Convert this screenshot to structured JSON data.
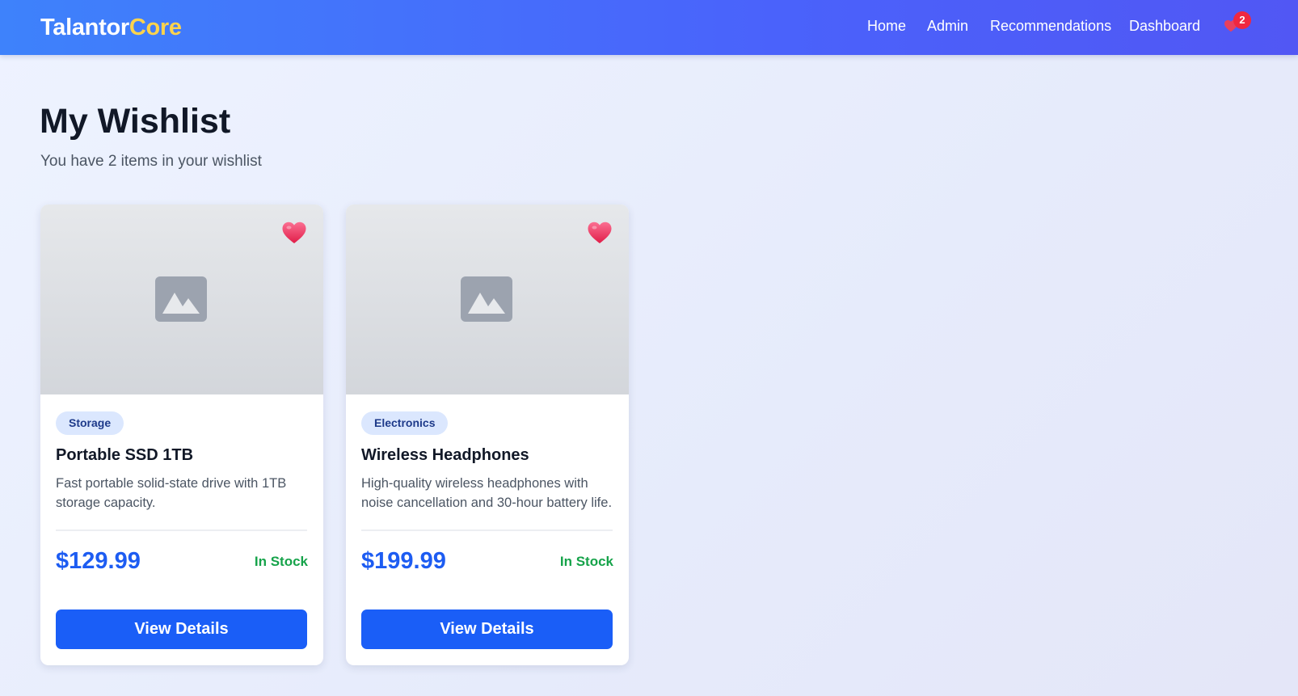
{
  "brand": {
    "name_part1": "Talantor",
    "name_part2": "Core"
  },
  "nav": {
    "links": [
      {
        "label": "Home"
      },
      {
        "label": "Admin"
      },
      {
        "label": "Recommendations"
      },
      {
        "label": "Dashboard"
      }
    ],
    "wishlist_count": "2"
  },
  "page": {
    "title": "My Wishlist",
    "subtitle": "You have 2 items in your wishlist"
  },
  "products": [
    {
      "category": "Storage",
      "name": "Portable SSD 1TB",
      "description": "Fast portable solid-state drive with 1TB storage capacity.",
      "price": "$129.99",
      "stock": "In Stock",
      "button_label": "View Details"
    },
    {
      "category": "Electronics",
      "name": "Wireless Headphones",
      "description": "High-quality wireless headphones with noise cancellation and 30-hour battery life.",
      "price": "$199.99",
      "stock": "In Stock",
      "button_label": "View Details"
    }
  ],
  "icons": {
    "wishlist_nav": "heart-icon",
    "favorite": "heart-icon",
    "image_placeholder": "image-placeholder-icon"
  },
  "colors": {
    "accent": "#1a5ef7",
    "brand_highlight": "#fcd34d",
    "in_stock": "#16a34a",
    "heart": "#f43f5e",
    "badge": "#ef2740"
  }
}
